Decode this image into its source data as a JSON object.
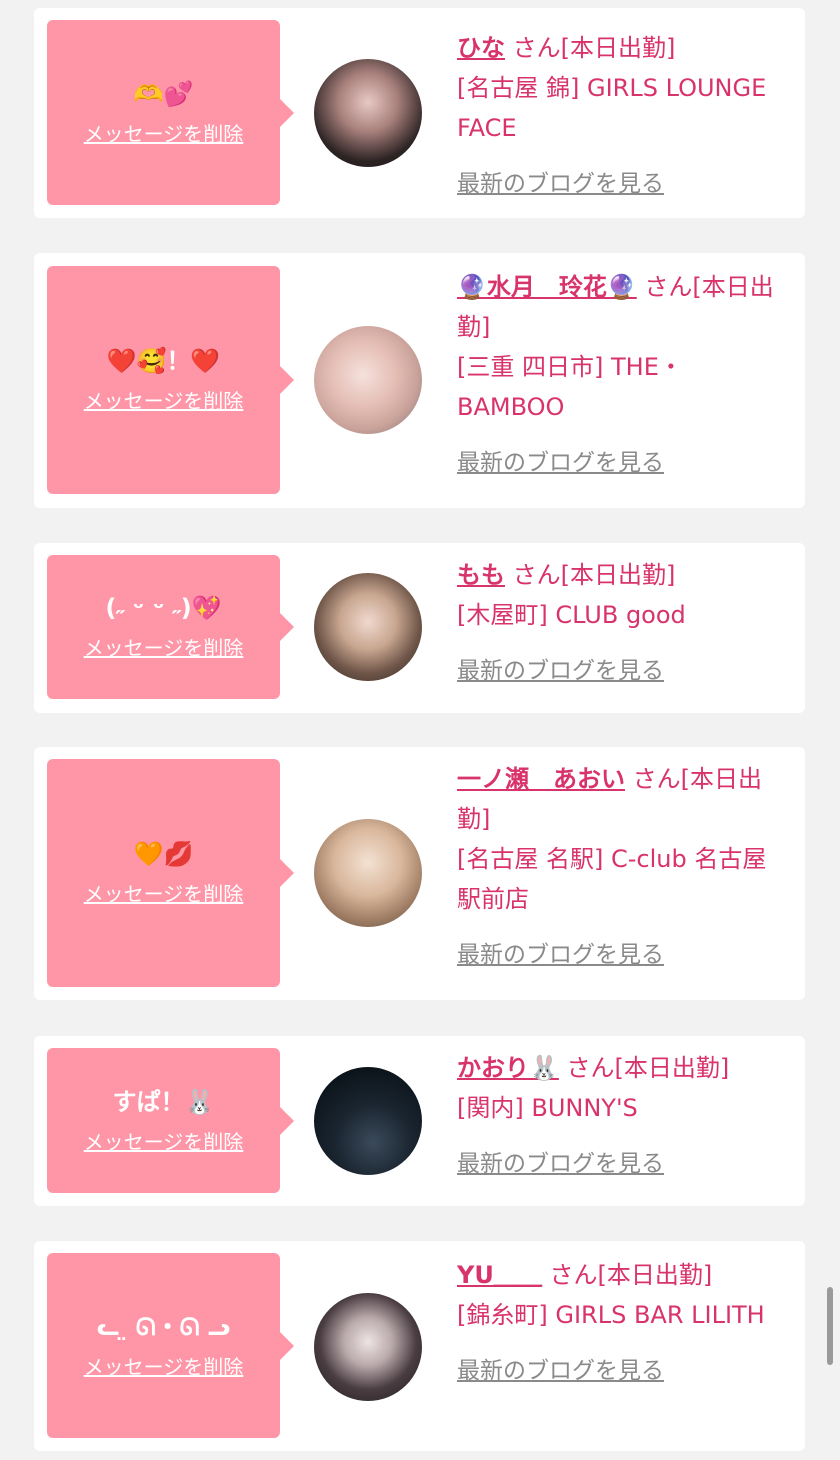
{
  "items": [
    {
      "message": "🫶💕",
      "delete_label": "メッセージを削除",
      "name": "ひな",
      "san_label": "さん[本日出勤]",
      "store": "[名古屋 錦] GIRLS LOUNGE FACE",
      "blog_label": "最新のブログを見る"
    },
    {
      "message": "❤️🥰！❤️",
      "delete_label": "メッセージを削除",
      "name": "🔮水月　玲花🔮",
      "san_label": "さん[本日出勤]",
      "store": "[三重 四日市] THE・BAMBOO",
      "blog_label": "最新のブログを見る"
    },
    {
      "message": "(˶ ᵕ ᵕ ˶)💖",
      "delete_label": "メッセージを削除",
      "name": "もも",
      "san_label": "さん[本日出勤]",
      "store": "[木屋町] CLUB good",
      "blog_label": "最新のブログを見る"
    },
    {
      "message": "🧡💋",
      "delete_label": "メッセージを削除",
      "name": "一ノ瀬　あおい",
      "san_label": "さん[本日出勤]",
      "store": "[名古屋 名駅] C-club 名古屋駅前店",
      "blog_label": "最新のブログを見る"
    },
    {
      "message": "すぱ！🐰",
      "delete_label": "メッセージを削除",
      "name": "かおり🐰",
      "san_label": "さん[本日出勤]",
      "store": "[関内] BUNNY'S",
      "blog_label": "最新のブログを見る"
    },
    {
      "message": "ᓚ ̤ ᘏ・ᘏ ᓗ",
      "delete_label": "メッセージを削除",
      "name": "YU＿＿",
      "san_label": "さん[本日出勤]",
      "store": "[錦糸町] GIRLS BAR LILITH",
      "blog_label": "最新のブログを見る"
    }
  ]
}
